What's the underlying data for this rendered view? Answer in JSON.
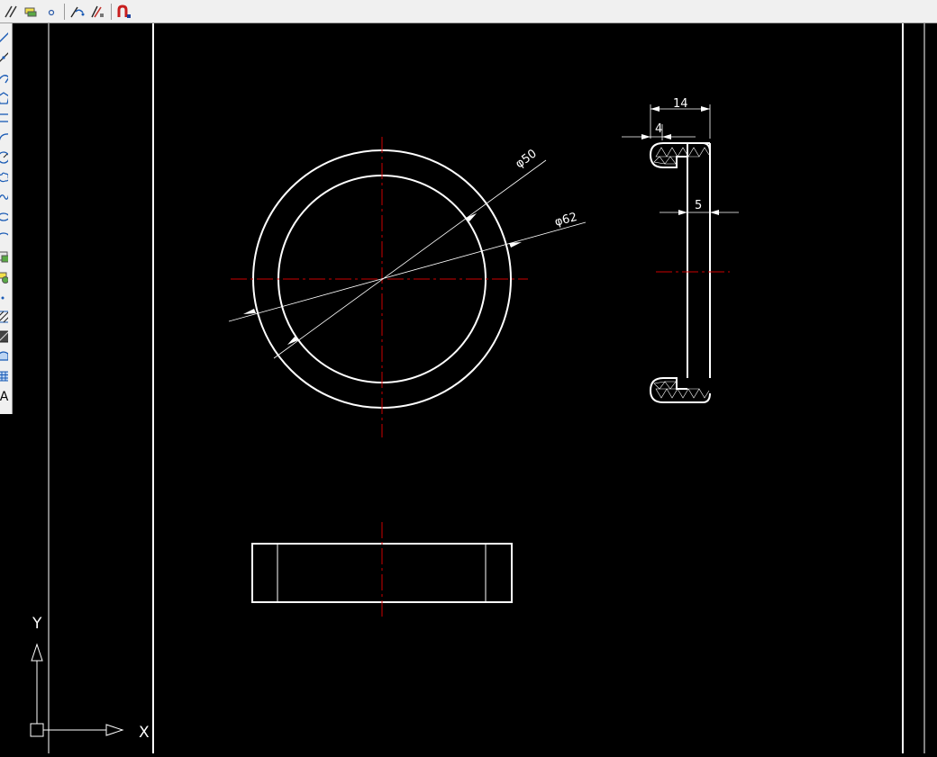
{
  "toolbar": {
    "top_items": [
      {
        "name": "parallel-lines-icon"
      },
      {
        "name": "layer-tool-icon"
      },
      {
        "name": "small-circle-icon"
      },
      {
        "name": "match-properties-icon"
      },
      {
        "name": "edit-properties-icon"
      },
      {
        "name": "magnet-snap-icon"
      }
    ],
    "left_items": [
      {
        "name": "line-tool-icon"
      },
      {
        "name": "construction-line-icon"
      },
      {
        "name": "polyline-tool-icon"
      },
      {
        "name": "polygon-tool-icon"
      },
      {
        "name": "rectangle-tool-icon"
      },
      {
        "name": "arc-tool-icon"
      },
      {
        "name": "circle-tool-icon"
      },
      {
        "name": "revision-cloud-icon"
      },
      {
        "name": "spline-tool-icon"
      },
      {
        "name": "ellipse-tool-icon"
      },
      {
        "name": "ellipse-arc-icon"
      },
      {
        "name": "insert-block-icon"
      },
      {
        "name": "make-block-icon"
      },
      {
        "name": "point-tool-icon"
      },
      {
        "name": "hatch-tool-icon"
      },
      {
        "name": "gradient-tool-icon"
      },
      {
        "name": "region-tool-icon"
      },
      {
        "name": "table-tool-icon"
      },
      {
        "name": "multiline-text-icon",
        "label": "A"
      }
    ]
  },
  "drawing": {
    "dimensions": {
      "dia_inner": "φ50",
      "dia_outer": "φ62",
      "width_total": "14",
      "width_lip": "4",
      "thickness": "5"
    },
    "ucs": {
      "x_label": "X",
      "y_label": "Y"
    }
  },
  "colors": {
    "background": "#000000",
    "geometry": "#ffffff",
    "centerline": "#cc0000",
    "toolbar_bg": "#f0f0f0"
  }
}
